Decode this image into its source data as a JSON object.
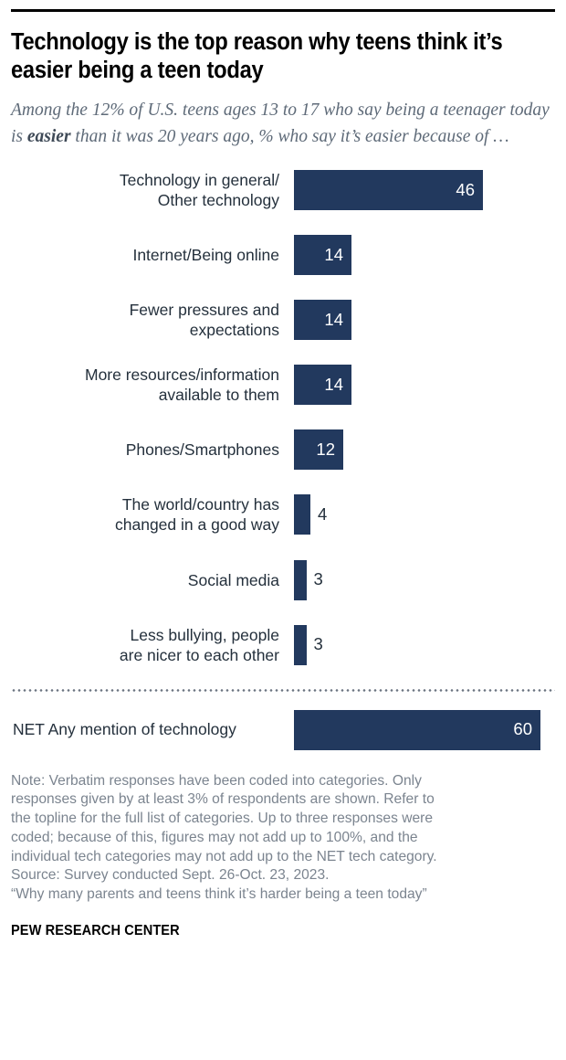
{
  "title": "Technology is the top reason why teens think it’s easier being a teen today",
  "subtitle": {
    "part1": "Among the 12% of U.S. teens ages 13 to 17 who say being a teenager today is ",
    "emphasis": "easier",
    "part2": " than it was 20 years ago, % who say it’s easier because of …"
  },
  "colors": {
    "bar": "#22395e",
    "bar_label_inside": "#ffffff",
    "bar_label_outside": "#24303c",
    "subtitle": "#5e6a78",
    "note": "#7b848f",
    "rule": "#000000"
  },
  "chart_data": {
    "type": "bar",
    "orientation": "horizontal",
    "title": "Technology is the top reason why teens think it’s easier being a teen today",
    "subtitle": "Among the 12% of U.S. teens ages 13 to 17 who say being a teenager today is easier than it was 20 years ago, % who say it’s easier because of …",
    "xlabel": "",
    "ylabel": "",
    "xlim": [
      0,
      60
    ],
    "grid": false,
    "legend": false,
    "unit": "%",
    "categories": [
      "Technology in general/\nOther technology",
      "Internet/Being online",
      "Fewer pressures and\nexpectations",
      "More resources/information\navailable to them",
      "Phones/Smartphones",
      "The world/country has\nchanged in a good way",
      "Social media",
      "Less bullying, people\nare nicer to each other"
    ],
    "values": [
      46,
      14,
      14,
      14,
      12,
      4,
      3,
      3
    ],
    "label_inside": [
      true,
      true,
      true,
      true,
      true,
      false,
      false,
      false
    ],
    "net": {
      "category": "NET Any mention of technology",
      "value": 60,
      "label_inside": true
    }
  },
  "note": {
    "lines": [
      "Note: Verbatim responses have been coded into categories. Only",
      "responses given by at least 3% of respondents are shown. Refer to",
      "the topline for the full list of categories. Up to three responses were",
      "coded; because of this, figures may not add up to 100%, and the",
      "individual tech categories may not add up to the NET tech category.",
      "Source: Survey conducted Sept. 26-Oct. 23, 2023.",
      "“Why many parents and teens think it’s harder being a teen today”"
    ]
  },
  "brand": "PEW RESEARCH CENTER"
}
